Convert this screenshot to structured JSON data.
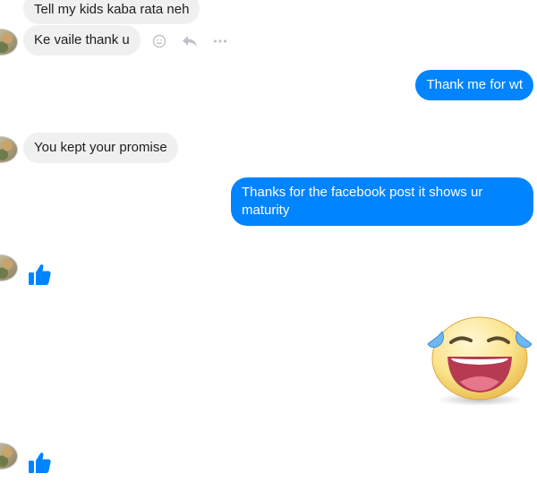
{
  "messages": [
    {
      "side": "in",
      "text": "Tell my kids kaba rata neh"
    },
    {
      "side": "in",
      "text": "Ke vaile thank u"
    },
    {
      "side": "out",
      "text": "Thank me for wt"
    },
    {
      "side": "in",
      "text": "You kept your promise"
    },
    {
      "side": "out",
      "text": "Thanks for the facebook post it shows ur maturity"
    }
  ],
  "message_actions": {
    "icons": [
      "emoji-icon",
      "reply-icon",
      "more-icon"
    ]
  },
  "stickers": [
    "thumbs-up-sticker",
    "laughing-crying-sticker",
    "thumbs-up-sticker"
  ],
  "colors": {
    "outgoing_bubble": "#0084ff",
    "incoming_bubble": "#f1f0f0",
    "like_blue": "#0084ff"
  }
}
